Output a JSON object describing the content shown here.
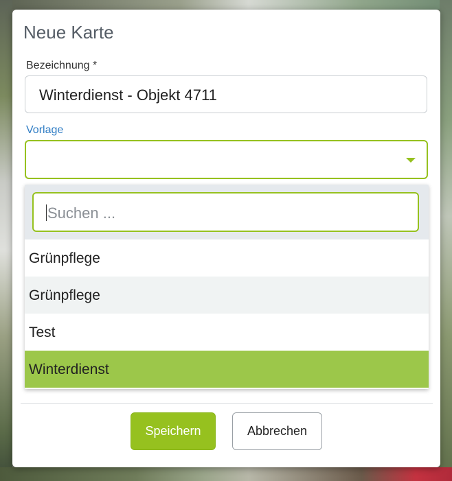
{
  "dialog": {
    "title": "Neue Karte",
    "name_label": "Bezeichnung *",
    "name_value": "Winterdienst - Objekt 4711",
    "template_label": "Vorlage",
    "template_value": ""
  },
  "dropdown": {
    "search_placeholder": "Suchen ...",
    "options": [
      "Grünpflege",
      "Grünpflege",
      "Test",
      "Winterdienst"
    ],
    "selected": "Winterdienst"
  },
  "buttons": {
    "save": "Speichern",
    "cancel": "Abbrechen"
  },
  "colors": {
    "accent": "#96c11f",
    "selected_option": "#9cc74a",
    "active_label": "#2e7cc4"
  }
}
